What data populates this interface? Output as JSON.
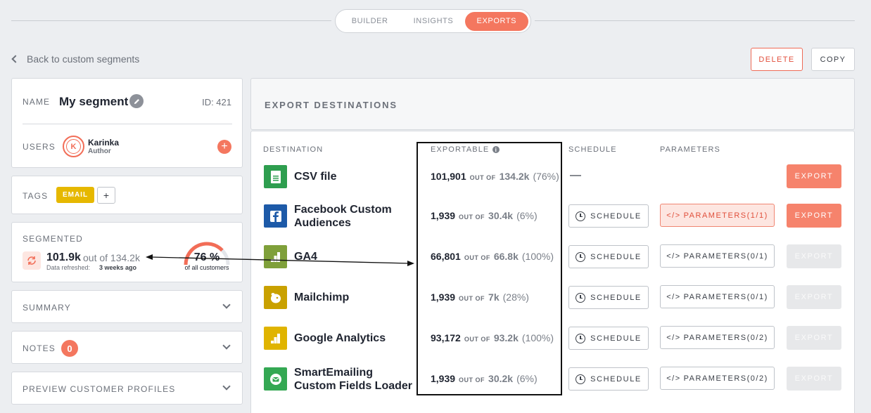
{
  "tabs": [
    {
      "label": "BUILDER"
    },
    {
      "label": "INSIGHTS"
    },
    {
      "label": "EXPORTS",
      "active": true
    }
  ],
  "back_label": "Back to custom segments",
  "actions": {
    "delete": "DELETE",
    "copy": "COPY"
  },
  "segment": {
    "name_label": "NAME",
    "name": "My segment",
    "id": "ID: 421",
    "users_label": "USERS",
    "user": {
      "initial": "K",
      "name": "Karinka",
      "role": "Author"
    },
    "tags_label": "TAGS",
    "tags": [
      "EMAIL"
    ],
    "add_tag": "+",
    "segmented_label": "SEGMENTED",
    "segmented_value": "101.9k",
    "segmented_outof": "out of 134.2k",
    "refreshed_prefix": "Data refreshed:",
    "refreshed_value": "3 weeks ago",
    "gauge_percent": "76 %",
    "gauge_fraction": 0.76,
    "gauge_caption": "of all customers",
    "summary_label": "SUMMARY",
    "notes_label": "NOTES",
    "notes_count": "0",
    "preview_label": "PREVIEW CUSTOMER PROFILES"
  },
  "exports": {
    "title": "EXPORT DESTINATIONS",
    "columns": {
      "destination": "DESTINATION",
      "exportable": "EXPORTABLE",
      "schedule": "SCHEDULE",
      "parameters": "PARAMETERS"
    },
    "out_of_label": "OUT OF",
    "schedule_label": "SCHEDULE",
    "export_label": "EXPORT",
    "rows": [
      {
        "name": "CSV file",
        "icon": "csv-file-icon",
        "icon_color": "#2e9e4f",
        "exportable": "101,901",
        "total": "134.2k",
        "percent": "(76%)",
        "schedule": "—",
        "parameters": "",
        "export_enabled": true
      },
      {
        "name": "Facebook Custom Audiences",
        "icon": "facebook-icon",
        "icon_color": "#1d5aa8",
        "exportable": "1,939",
        "total": "30.4k",
        "percent": "(6%)",
        "parameters": "PARAMETERS(1/1)",
        "params_active": true,
        "export_enabled": true
      },
      {
        "name": "GA4",
        "icon": "ga4-icon",
        "icon_color": "#7fa03a",
        "exportable": "66,801",
        "total": "66.8k",
        "percent": "(100%)",
        "parameters": "PARAMETERS(0/1)",
        "export_enabled": false
      },
      {
        "name": "Mailchimp",
        "icon": "mailchimp-icon",
        "icon_color": "#c9a100",
        "exportable": "1,939",
        "total": "7k",
        "percent": "(28%)",
        "parameters": "PARAMETERS(0/1)",
        "export_enabled": false
      },
      {
        "name": "Google Analytics",
        "icon": "google-analytics-icon",
        "icon_color": "#e0b400",
        "exportable": "93,172",
        "total": "93.2k",
        "percent": "(100%)",
        "parameters": "PARAMETERS(0/2)",
        "export_enabled": false
      },
      {
        "name": "SmartEmailing Custom Fields Loader",
        "icon": "smartemailing-icon",
        "icon_color": "#34a853",
        "exportable": "1,939",
        "total": "30.2k",
        "percent": "(6%)",
        "parameters": "PARAMETERS(0/2)",
        "export_enabled": false
      }
    ]
  },
  "colors": {
    "accent": "#f4775f",
    "tag": "#e6b800"
  }
}
